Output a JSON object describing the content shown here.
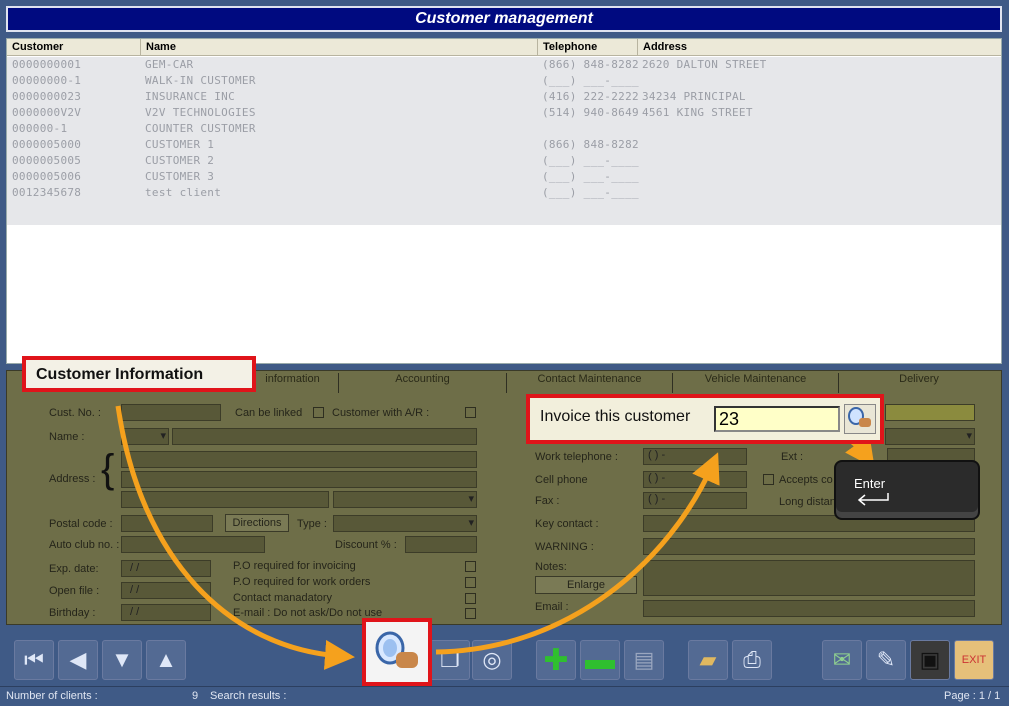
{
  "window": {
    "title": "Customer management"
  },
  "grid": {
    "headers": {
      "customer": "Customer",
      "name": "Name",
      "telephone": "Telephone",
      "address": "Address"
    },
    "rows": [
      {
        "customer": "0000000001",
        "name": "GEM-CAR",
        "telephone": "(866) 848-8282",
        "address": "2620 DALTON STREET"
      },
      {
        "customer": "00000000-1",
        "name": "WALK-IN CUSTOMER",
        "telephone": "(___) ___-____",
        "address": ""
      },
      {
        "customer": "0000000023",
        "name": "INSURANCE INC",
        "telephone": "(416) 222-2222",
        "address": "34234 PRINCIPAL"
      },
      {
        "customer": "0000000V2V",
        "name": "V2V TECHNOLOGIES",
        "telephone": "(514) 940-8649",
        "address": "4561 KING STREET"
      },
      {
        "customer": "000000-1",
        "name": "COUNTER CUSTOMER",
        "telephone": "",
        "address": ""
      },
      {
        "customer": "0000005000",
        "name": "CUSTOMER 1",
        "telephone": "(866) 848-8282",
        "address": ""
      },
      {
        "customer": "0000005005",
        "name": "CUSTOMER 2",
        "telephone": "(___) ___-____",
        "address": ""
      },
      {
        "customer": "0000005006",
        "name": "CUSTOMER 3",
        "telephone": "(___) ___-____",
        "address": ""
      },
      {
        "customer": "0012345678",
        "name": "test client",
        "telephone": "(___) ___-____",
        "address": ""
      }
    ]
  },
  "tabs": [
    "Customer Information",
    "information",
    "Accounting",
    "Contact Maintenance",
    "Vehicle Maintenance",
    "Delivery"
  ],
  "form": {
    "cust_no": "Cust. No. :",
    "can_be_linked": "Can be linked",
    "customer_ar": "Customer with A/R :",
    "name": "Name :",
    "address": "Address :",
    "postal_code": "Postal code :",
    "directions": "Directions",
    "type": "Type :",
    "auto_club": "Auto club no. :",
    "discount": "Discount % :",
    "exp_date": "Exp. date:",
    "open_file": "Open file :",
    "birthday": "Birthday :",
    "date_mask": "/ /",
    "po_invoicing": "P.O required for invoicing",
    "po_work_orders": "P.O required for work orders",
    "contact_mandatory": "Contact manadatory",
    "email_no_ask": "E-mail : Do not ask/Do not use",
    "work_tel": "Work telephone :",
    "cell_phone": "Cell phone",
    "fax": "Fax :",
    "ext": "Ext :",
    "accepts": "Accepts co",
    "long_dist": "Long distan",
    "key_contact": "Key contact :",
    "warning": "WARNING :",
    "notes": "Notes:",
    "enlarge": "Enlarge",
    "email": "Email :",
    "phone_mask": "(  )    -"
  },
  "callouts": {
    "customer_information": "Customer Information",
    "invoice_label": "Invoice this customer",
    "invoice_value": "23",
    "enter_key": "Enter"
  },
  "status": {
    "num_clients_label": "Number of clients :",
    "num_clients_value": "9",
    "search_results_label": "Search results :",
    "page": "Page : 1 / 1"
  },
  "toolbar_icons": [
    "first-record-icon",
    "previous-record-icon",
    "next-record-icon",
    "last-record-icon",
    "search-icon",
    "copy-icon",
    "binoculars-icon",
    "add-icon",
    "remove-icon",
    "save-icon",
    "folders-icon",
    "print-icon",
    "email-icon",
    "report-icon",
    "briefcase-icon",
    "exit-icon"
  ],
  "colors": {
    "title_bg": "#000a80",
    "callout_border": "#e0141a",
    "arrow": "#f5a11d",
    "panel": "#6e6e48"
  }
}
